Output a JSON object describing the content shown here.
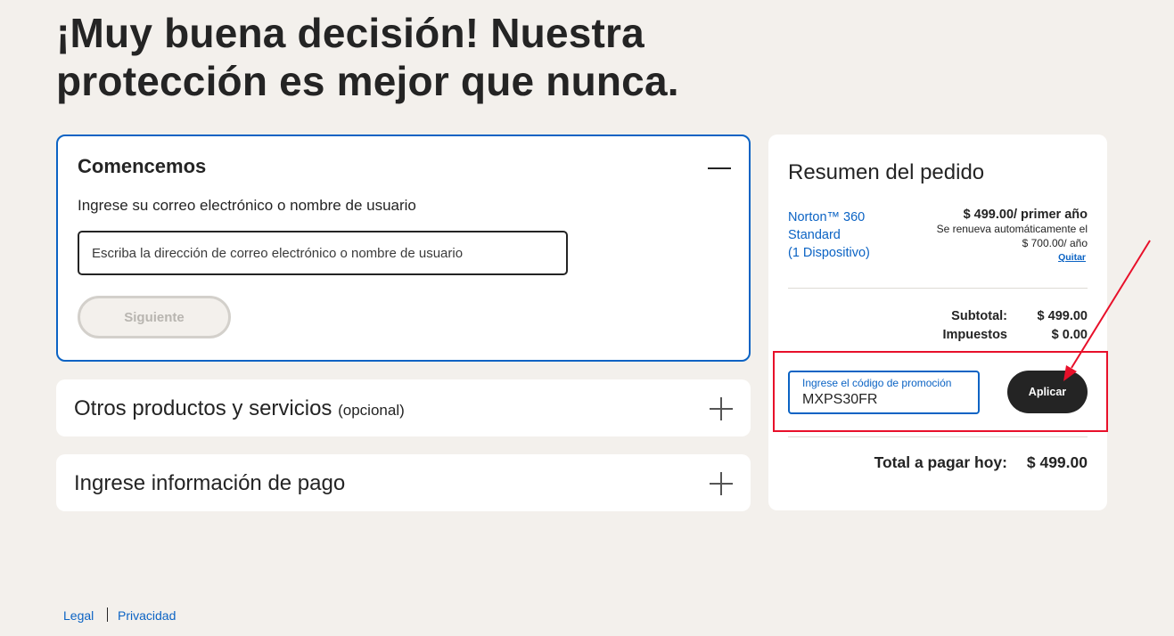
{
  "headline": "¡Muy buena decisión! Nuestra protección es mejor que nunca.",
  "start_section": {
    "title": "Comencemos",
    "prompt": "Ingrese su correo electrónico o nombre de usuario",
    "email_placeholder": "Escriba la dirección de correo electrónico o nombre de usuario",
    "email_value": "",
    "next_label": "Siguiente"
  },
  "other_section": {
    "title": "Otros productos y servicios",
    "optional_label": "(opcional)"
  },
  "payment_section": {
    "title": "Ingrese información de pago"
  },
  "summary": {
    "title": "Resumen del pedido",
    "product": {
      "name_line1": "Norton™ 360",
      "name_line2": "Standard",
      "name_line3": "(1 Dispositivo)",
      "price": "$ 499.00/ primer año",
      "renew_line1": "Se renueva automáticamente el",
      "renew_line2": "$ 700.00/ año",
      "remove_label": "Quitar"
    },
    "subtotal_label": "Subtotal:",
    "subtotal_value": "$ 499.00",
    "taxes_label": "Impuestos",
    "taxes_value": "$ 0.00",
    "promo": {
      "label": "Ingrese el código de promoción",
      "value": "MXPS30FR",
      "apply_label": "Aplicar"
    },
    "total_label": "Total a pagar hoy:",
    "total_value": "$ 499.00"
  },
  "footer": {
    "legal": "Legal",
    "privacy": "Privacidad"
  },
  "colors": {
    "accent_blue": "#0b63c4",
    "annotation_red": "#e8102a",
    "background": "#f3f0ec",
    "dark": "#242424"
  }
}
